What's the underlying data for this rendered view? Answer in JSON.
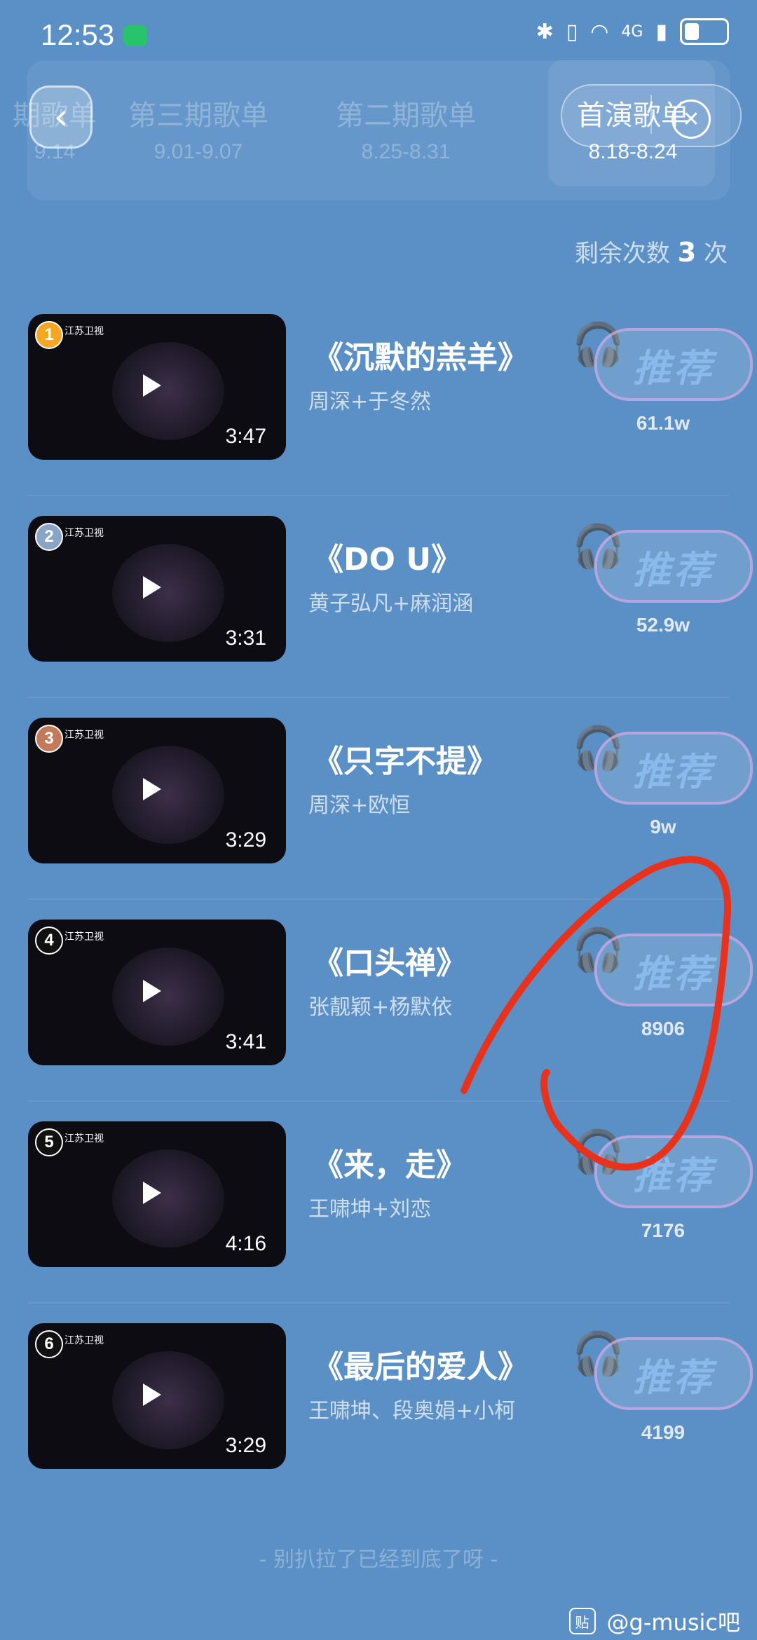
{
  "status_bar": {
    "time": "12:53",
    "network": "4G"
  },
  "tabs": [
    {
      "title": "期歌单",
      "date": "9.14"
    },
    {
      "title": "第三期歌单",
      "date": "9.01-9.07"
    },
    {
      "title": "第二期歌单",
      "date": "8.25-8.31"
    },
    {
      "title": "首演歌单",
      "date": "8.18-8.24"
    }
  ],
  "remaining": {
    "prefix": "剩余次数",
    "count": "3",
    "suffix": "次"
  },
  "recommend_label": "推荐",
  "songs": [
    {
      "rank": "1",
      "title": "《沉默的羔羊》",
      "artists": "周深+于冬然",
      "duration": "3:47",
      "votes": "61.1w",
      "channel": "江苏卫视"
    },
    {
      "rank": "2",
      "title": "《DO U》",
      "artists": "黄子弘凡+麻润涵",
      "duration": "3:31",
      "votes": "52.9w",
      "channel": "江苏卫视"
    },
    {
      "rank": "3",
      "title": "《只字不提》",
      "artists": "周深+欧恒",
      "duration": "3:29",
      "votes": "9w",
      "channel": "江苏卫视"
    },
    {
      "rank": "4",
      "title": "《口头禅》",
      "artists": "张靓颖+杨默依",
      "duration": "3:41",
      "votes": "8906",
      "channel": "江苏卫视"
    },
    {
      "rank": "5",
      "title": "《来，走》",
      "artists": "王啸坤+刘恋",
      "duration": "4:16",
      "votes": "7176",
      "channel": "江苏卫视"
    },
    {
      "rank": "6",
      "title": "《最后的爱人》",
      "artists": "王啸坤、段奥娟+小柯",
      "duration": "3:29",
      "votes": "4199",
      "channel": "江苏卫视"
    }
  ],
  "bottom_note": "- 别扒拉了已经到底了呀 -",
  "watermark": {
    "badge": "贴",
    "text": "@g-music吧"
  }
}
